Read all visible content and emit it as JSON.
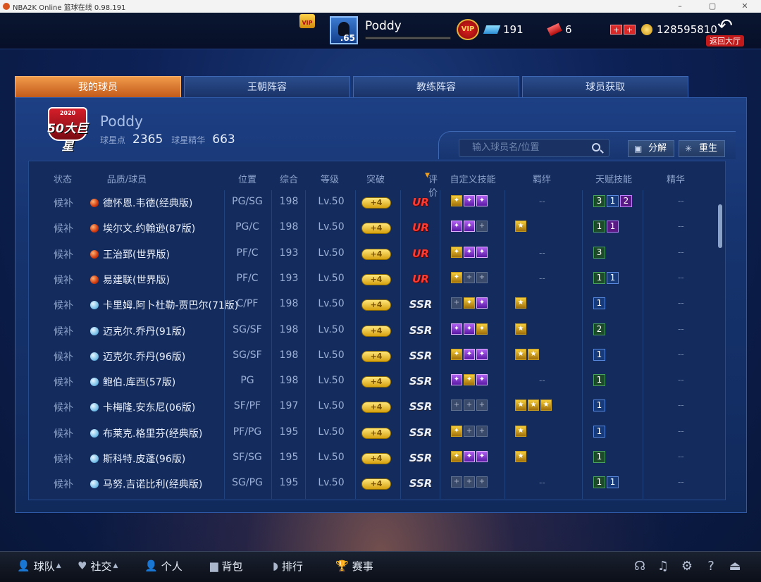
{
  "window": {
    "title": "NBA2K Online 篮球在线 0.98.191"
  },
  "header": {
    "vip_crown": "VIP",
    "avatar_level": ".65",
    "player_name": "Poddy",
    "vip_badge": "VIP",
    "tickets": "191",
    "rubies": "6",
    "coins": "128595810",
    "back_label": "返回大厅"
  },
  "tabs": [
    {
      "label": "我的球员",
      "active": true
    },
    {
      "label": "王朝阵容",
      "active": false
    },
    {
      "label": "教练阵容",
      "active": false
    },
    {
      "label": "球员获取",
      "active": false
    }
  ],
  "profile": {
    "logo_year": "2020",
    "logo_text": "50大巨星",
    "name": "Poddy",
    "star_points_label": "球星点",
    "star_points": "2365",
    "essence_label": "球星精华",
    "essence": "663"
  },
  "search": {
    "placeholder": "输入球员名/位置"
  },
  "actions": {
    "decompose": "分解",
    "rebirth": "重生"
  },
  "table": {
    "headers": {
      "status": "状态",
      "player": "品质/球员",
      "position": "位置",
      "overall": "综合",
      "level": "等级",
      "breakthrough": "突破",
      "rating": "评价",
      "custom_skills": "自定义技能",
      "bonds": "羁绊",
      "talent": "天赋技能",
      "essence": "精华"
    },
    "rows": [
      {
        "status": "候补",
        "quality": "ur",
        "name": "德怀恩.韦德(经典版)",
        "position": "PG/SG",
        "overall": "198",
        "level": "Lv.50",
        "break": "+4",
        "grade": "UR",
        "skills": [
          "gold",
          "purple",
          "purple"
        ],
        "bonds": [],
        "talent": [
          [
            "green",
            "3"
          ],
          [
            "blue",
            "1"
          ],
          [
            "purple",
            "2"
          ]
        ],
        "essence": "--"
      },
      {
        "status": "候补",
        "quality": "ur",
        "name": "埃尔文.约翰逊(87版)",
        "position": "PG/C",
        "overall": "198",
        "level": "Lv.50",
        "break": "+4",
        "grade": "UR",
        "skills": [
          "purple",
          "purple",
          "empty"
        ],
        "bonds": [
          "gold"
        ],
        "talent": [
          [
            "green",
            "1"
          ],
          [
            "purple",
            "1"
          ]
        ],
        "essence": "--"
      },
      {
        "status": "候补",
        "quality": "ur",
        "name": "王治郅(世界版)",
        "position": "PF/C",
        "overall": "193",
        "level": "Lv.50",
        "break": "+4",
        "grade": "UR",
        "skills": [
          "gold",
          "purple",
          "purple"
        ],
        "bonds": [],
        "talent": [
          [
            "green",
            "3"
          ]
        ],
        "essence": "--"
      },
      {
        "status": "候补",
        "quality": "ur",
        "name": "易建联(世界版)",
        "position": "PF/C",
        "overall": "193",
        "level": "Lv.50",
        "break": "+4",
        "grade": "UR",
        "skills": [
          "gold",
          "empty",
          "empty"
        ],
        "bonds": [],
        "talent": [
          [
            "green",
            "1"
          ],
          [
            "blue",
            "1"
          ]
        ],
        "essence": "--"
      },
      {
        "status": "候补",
        "quality": "ssr",
        "name": "卡里姆.阿卜杜勒-贾巴尔(71版)",
        "position": "C/PF",
        "overall": "198",
        "level": "Lv.50",
        "break": "+4",
        "grade": "SSR",
        "skills": [
          "empty",
          "gold",
          "purple"
        ],
        "bonds": [
          "gold"
        ],
        "talent": [
          [
            "blue",
            "1"
          ]
        ],
        "essence": "--"
      },
      {
        "status": "候补",
        "quality": "ssr",
        "name": "迈克尔.乔丹(91版)",
        "position": "SG/SF",
        "overall": "198",
        "level": "Lv.50",
        "break": "+4",
        "grade": "SSR",
        "skills": [
          "purple",
          "purple",
          "gold"
        ],
        "bonds": [
          "gold"
        ],
        "talent": [
          [
            "green",
            "2"
          ]
        ],
        "essence": "--"
      },
      {
        "status": "候补",
        "quality": "ssr",
        "name": "迈克尔.乔丹(96版)",
        "position": "SG/SF",
        "overall": "198",
        "level": "Lv.50",
        "break": "+4",
        "grade": "SSR",
        "skills": [
          "gold",
          "purple",
          "purple"
        ],
        "bonds": [
          "gold",
          "gold"
        ],
        "talent": [
          [
            "blue",
            "1"
          ]
        ],
        "essence": "--"
      },
      {
        "status": "候补",
        "quality": "ssr",
        "name": "鲍伯.库西(57版)",
        "position": "PG",
        "overall": "198",
        "level": "Lv.50",
        "break": "+4",
        "grade": "SSR",
        "skills": [
          "purple",
          "gold",
          "purple"
        ],
        "bonds": [],
        "talent": [
          [
            "green",
            "1"
          ]
        ],
        "essence": "--"
      },
      {
        "status": "候补",
        "quality": "ssr",
        "name": "卡梅隆.安东尼(06版)",
        "position": "SF/PF",
        "overall": "197",
        "level": "Lv.50",
        "break": "+4",
        "grade": "SSR",
        "skills": [
          "empty",
          "empty",
          "empty"
        ],
        "bonds": [
          "gold",
          "gold",
          "gold"
        ],
        "talent": [
          [
            "blue",
            "1"
          ]
        ],
        "essence": "--"
      },
      {
        "status": "候补",
        "quality": "ssr",
        "name": "布莱克.格里芬(经典版)",
        "position": "PF/PG",
        "overall": "195",
        "level": "Lv.50",
        "break": "+4",
        "grade": "SSR",
        "skills": [
          "gold",
          "empty",
          "empty"
        ],
        "bonds": [
          "gold"
        ],
        "talent": [
          [
            "blue",
            "1"
          ]
        ],
        "essence": "--"
      },
      {
        "status": "候补",
        "quality": "ssr",
        "name": "斯科特.皮蓬(96版)",
        "position": "SF/SG",
        "overall": "195",
        "level": "Lv.50",
        "break": "+4",
        "grade": "SSR",
        "skills": [
          "gold",
          "purple",
          "purple"
        ],
        "bonds": [
          "gold"
        ],
        "talent": [
          [
            "green",
            "1"
          ]
        ],
        "essence": "--"
      },
      {
        "status": "候补",
        "quality": "ssr",
        "name": "马努.吉诺比利(经典版)",
        "position": "SG/PG",
        "overall": "195",
        "level": "Lv.50",
        "break": "+4",
        "grade": "SSR",
        "skills": [
          "empty",
          "empty",
          "empty"
        ],
        "bonds": [],
        "talent": [
          [
            "green",
            "1"
          ],
          [
            "blue",
            "1"
          ]
        ],
        "essence": "--"
      }
    ]
  },
  "bottom_nav": [
    {
      "label": "球队",
      "icon": "person-icon",
      "caret": true
    },
    {
      "label": "社交",
      "icon": "heart-icon",
      "caret": true
    },
    {
      "label": "个人",
      "icon": "user-icon",
      "caret": false
    },
    {
      "label": "背包",
      "icon": "bag-icon",
      "caret": false
    },
    {
      "label": "排行",
      "icon": "rank-icon",
      "caret": false
    },
    {
      "label": "赛事",
      "icon": "trophy-icon",
      "caret": false
    }
  ],
  "system_icons": [
    "headset-icon",
    "music-icon",
    "gear-icon",
    "help-icon",
    "exit-icon"
  ]
}
